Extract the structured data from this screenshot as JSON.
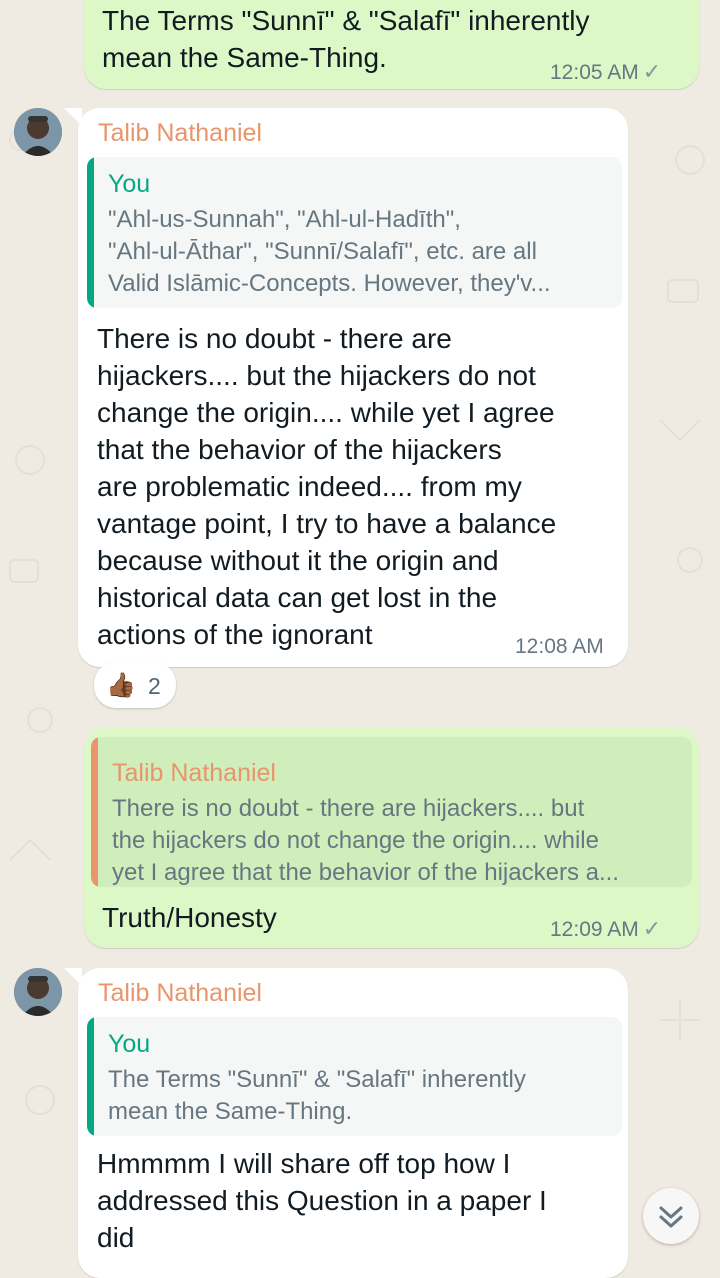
{
  "messages": [
    {
      "direction": "outgoing",
      "text_lines": [
        "The Terms \"Sunnī\" & \"Salafī\" inherently",
        "mean the Same-Thing."
      ],
      "time": "12:05 AM",
      "status": "✓"
    },
    {
      "direction": "incoming",
      "sender": "Talib Nathaniel",
      "quote": {
        "author": "You",
        "lines": [
          "\"Ahl-us-Sunnah\", \"Ahl-ul-Hadīth\",",
          "\"Ahl-ul-Āthar\", \"Sunnī/Salafī\", etc. are all",
          "Valid Islāmic-Concepts. However, they'v..."
        ]
      },
      "text_lines": [
        "There is no doubt - there are",
        "hijackers.... but the hijackers do not",
        "change the origin.... while yet I agree",
        "that the behavior of the hijackers",
        "are problematic indeed.... from my",
        "vantage point, I try to have a balance",
        "because without it the origin and",
        "historical data can get lost in the",
        "actions of the ignorant"
      ],
      "time": "12:08 AM",
      "reaction": {
        "emoji": "👍🏾",
        "count": "2"
      }
    },
    {
      "direction": "outgoing",
      "quote": {
        "author": "Talib Nathaniel",
        "lines": [
          "There is no doubt - there are hijackers.... but",
          "the hijackers do not change the origin.... while",
          "yet I agree that the behavior of the hijackers a..."
        ]
      },
      "text_lines": [
        "Truth/Honesty"
      ],
      "time": "12:09 AM",
      "status": "✓"
    },
    {
      "direction": "incoming",
      "sender": "Talib Nathaniel",
      "quote": {
        "author": "You",
        "lines": [
          "The Terms \"Sunnī\" & \"Salafī\" inherently",
          "mean the Same-Thing."
        ]
      },
      "text_lines": [
        "Hmmmm I will share off top how I",
        "addressed this Question in a paper I",
        "did"
      ]
    }
  ],
  "colors": {
    "outgoing_bubble": "#dcf8c6",
    "incoming_bubble": "#ffffff",
    "sender_name": "#e8956b",
    "quote_you": "#06a884",
    "quote_other": "#e8956b",
    "chat_background": "#efeae2"
  },
  "icons": {
    "scroll": "double-chevron-down-icon",
    "status": "single-check-icon"
  }
}
